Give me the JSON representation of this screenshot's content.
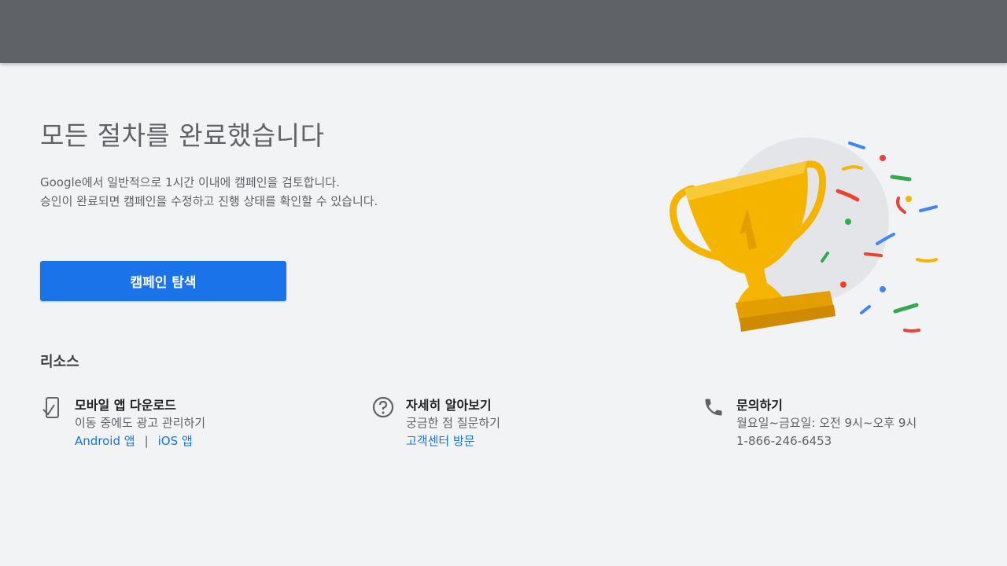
{
  "header": {
    "bar_color": "#5f6368"
  },
  "main": {
    "title": "모든 절차를 완료했습니다",
    "desc_line1": "Google에서 일반적으로 1시간 이내에 캠페인을 검토합니다.",
    "desc_line2": "승인이 완료되면 캠페인을 수정하고 진행 상태를 확인할 수 있습니다.",
    "cta_label": "캠페인 탐색",
    "accent_color": "#1a73e8"
  },
  "resources": {
    "title": "리소스",
    "items": [
      {
        "icon": "mobile-phone-icon",
        "heading": "모바일 앱 다운로드",
        "sub": "이동 중에도 광고 관리하기",
        "link1": "Android 앱",
        "separator": "|",
        "link2": "iOS 앱"
      },
      {
        "icon": "help-circle-icon",
        "heading": "자세히 알아보기",
        "sub": "궁금한 점 질문하기",
        "link1": "고객센터 방문"
      },
      {
        "icon": "phone-icon",
        "heading": "문의하기",
        "sub": "월요일~금요일: 오전 9시~오후 9시",
        "phone": "1-866-246-6453"
      }
    ]
  },
  "illustration": {
    "icon": "trophy-confetti-icon"
  }
}
